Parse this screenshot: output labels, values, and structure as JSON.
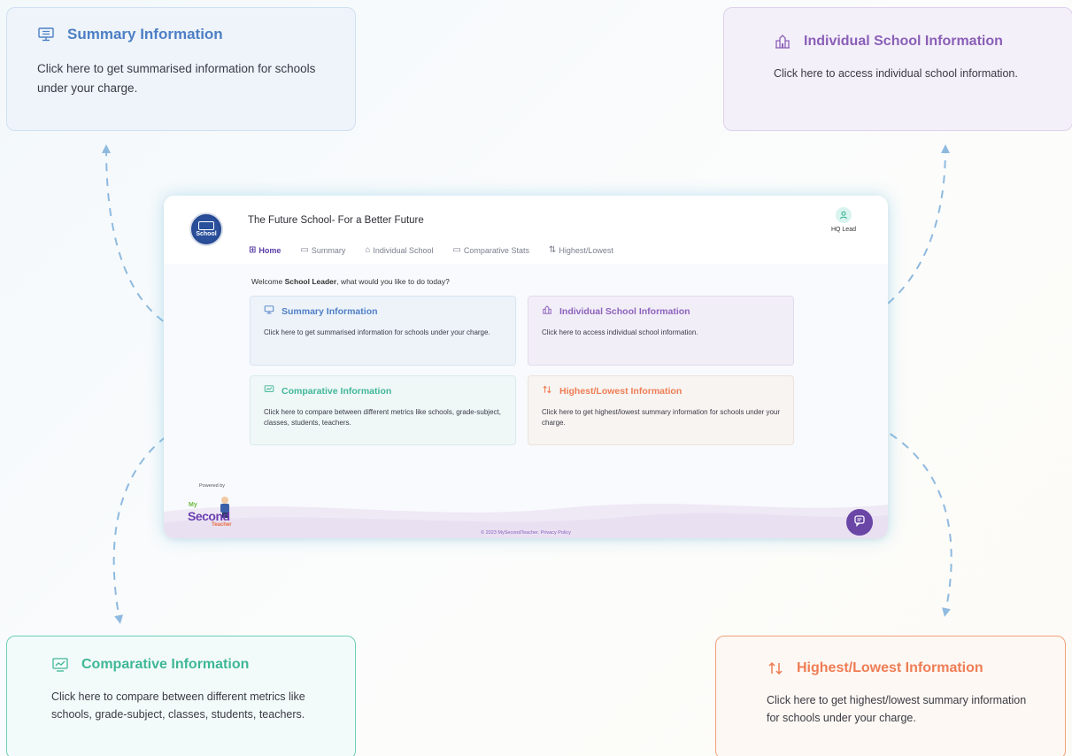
{
  "callouts": {
    "summary": {
      "title": "Summary Information",
      "desc": "Click here to get summarised information for schools under your charge."
    },
    "individual": {
      "title": "Individual School Information",
      "desc": "Click here to access individual school information."
    },
    "comparative": {
      "title": "Comparative Information",
      "desc": "Click here to compare between different metrics like schools, grade-subject, classes, students, teachers."
    },
    "highest": {
      "title": "Highest/Lowest Information",
      "desc": "Click here to get highest/lowest summary information for schools under your charge."
    }
  },
  "app": {
    "logo_text": "School",
    "title": "The Future School- For a Better Future",
    "nav": [
      {
        "label": "Home",
        "icon": "grid-icon"
      },
      {
        "label": "Summary",
        "icon": "monitor-icon"
      },
      {
        "label": "Individual School",
        "icon": "school-icon"
      },
      {
        "label": "Comparative Stats",
        "icon": "chart-icon"
      },
      {
        "label": "Highest/Lowest",
        "icon": "sort-arrows-icon"
      }
    ],
    "user_role": "HQ Lead",
    "welcome_prefix": "Welcome ",
    "welcome_name": "School Leader",
    "welcome_suffix": ", what would you like to do today?",
    "cards": {
      "summary": {
        "title": "Summary Information",
        "desc": "Click here to get summarised information for schools under your charge."
      },
      "individual": {
        "title": "Individual School Information",
        "desc": "Click here to access individual school information."
      },
      "comparative": {
        "title": "Comparative Information",
        "desc": "Click here to compare between different metrics like schools, grade-subject, classes, students, teachers."
      },
      "highest": {
        "title": "Highest/Lowest Information",
        "desc": "Click here to get highest/lowest summary information for schools under your charge."
      }
    },
    "powered_by": "Powered by",
    "brand_my": "My",
    "brand_second": "Second",
    "brand_teacher": "Teacher",
    "footer": "© 2023 MySecondTeacher. Privacy Policy"
  },
  "colors": {
    "summary": "#4d7fc4",
    "individual": "#8a5fb8",
    "comparative": "#3fb796",
    "highest": "#ef7d55",
    "arrow": "#8fbadf",
    "brand_purple": "#6a46a6"
  }
}
